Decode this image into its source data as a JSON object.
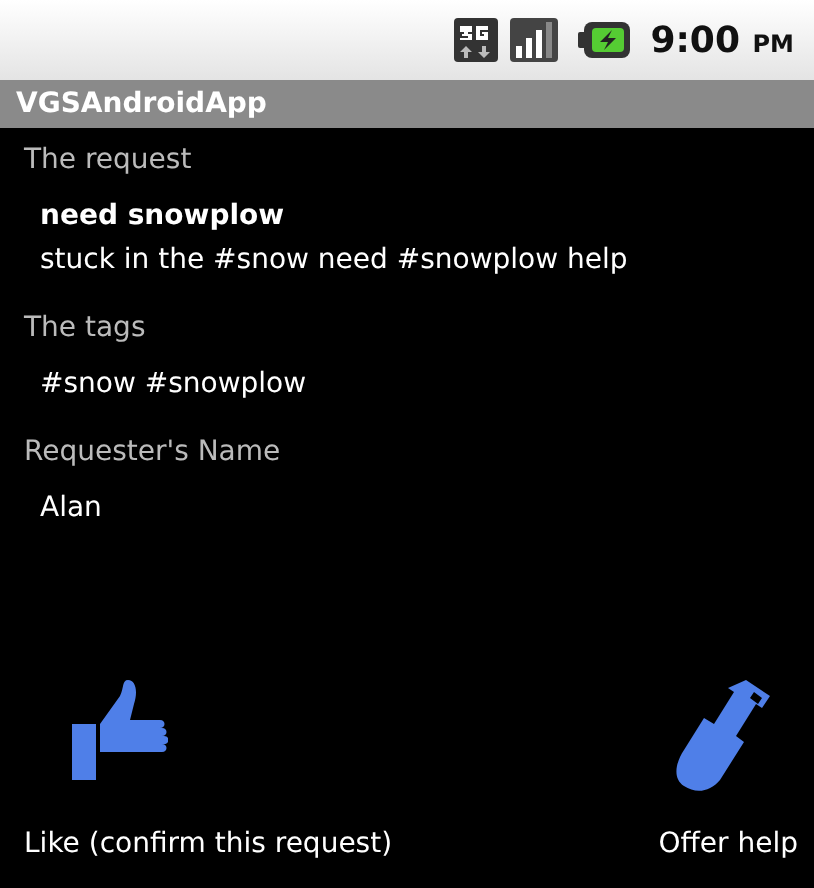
{
  "status_bar": {
    "time": "9:00",
    "ampm": "PM"
  },
  "window": {
    "title": "VGSAndroidApp"
  },
  "request": {
    "label": "The request",
    "title": "need snowplow",
    "body": "stuck in the #snow need #snowplow help"
  },
  "tags": {
    "label": "The tags",
    "value": "#snow #snowplow"
  },
  "requester": {
    "label": "Requester's Name",
    "value": "Alan"
  },
  "actions": [
    {
      "kind": "like",
      "label": "Like (confirm this request)"
    },
    {
      "kind": "help",
      "label": "Offer help"
    }
  ]
}
